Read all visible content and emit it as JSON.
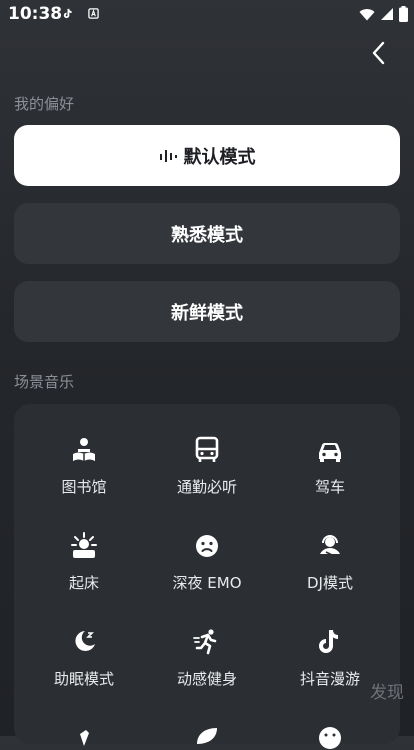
{
  "status_bar": {
    "time": "10:38",
    "battery": "8"
  },
  "header": {
    "back_icon": "chevron-left-icon"
  },
  "preferences": {
    "title": "我的偏好",
    "modes": [
      {
        "label": "默认模式",
        "active": true
      },
      {
        "label": "熟悉模式",
        "active": false
      },
      {
        "label": "新鲜模式",
        "active": false
      }
    ]
  },
  "scenes": {
    "title": "场景音乐",
    "items": [
      {
        "label": "图书馆",
        "icon": "library-icon"
      },
      {
        "label": "通勤必听",
        "icon": "bus-icon"
      },
      {
        "label": "驾车",
        "icon": "car-icon"
      },
      {
        "label": "起床",
        "icon": "sunrise-icon"
      },
      {
        "label": "深夜 EMO",
        "icon": "sad-face-icon"
      },
      {
        "label": "DJ模式",
        "icon": "dj-icon"
      },
      {
        "label": "助眠模式",
        "icon": "moon-icon"
      },
      {
        "label": "动感健身",
        "icon": "running-icon"
      },
      {
        "label": "抖音漫游",
        "icon": "tiktok-icon"
      }
    ]
  },
  "overlay": {
    "discover_label": "发现"
  },
  "colors": {
    "background": "#2b2e33",
    "active_mode_bg": "#ffffff",
    "inactive_mode_bg": "#33363b"
  }
}
